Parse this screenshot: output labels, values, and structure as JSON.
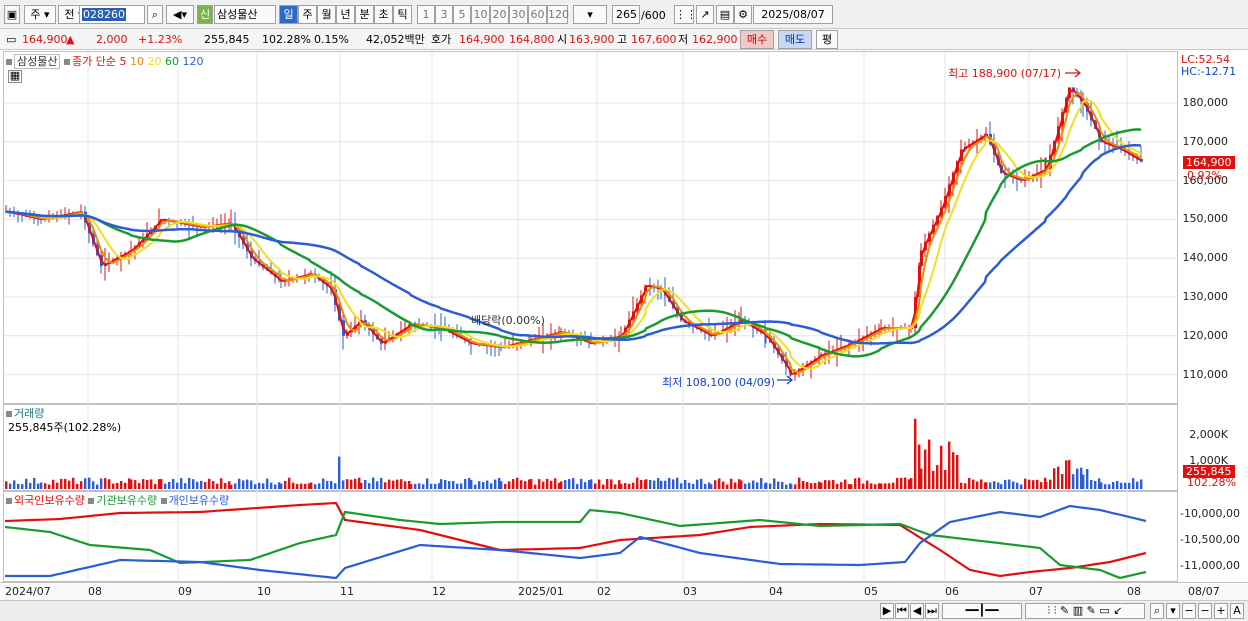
{
  "toolbar": {
    "type_select": "주",
    "range_select": "전",
    "code": "028260",
    "new_badge": "신",
    "stock_name": "삼성물산",
    "periods": [
      "일",
      "주",
      "월",
      "년",
      "분",
      "초",
      "틱"
    ],
    "intervals": [
      "1",
      "3",
      "5",
      "10",
      "20",
      "30",
      "60",
      "120"
    ],
    "count": "265",
    "total": "/600",
    "date": "2025/08/07"
  },
  "quote": {
    "price": "164,900",
    "change_arrow": "▲",
    "change": "2,000",
    "change_pct": "+1.23%",
    "volume": "255,845",
    "volume_ratio": "102.28%",
    "turnover": "0.15%",
    "amount": "42,052백만",
    "ask_label": "호가",
    "ask": "164,900",
    "bid": "164,800",
    "open_label": "시",
    "open": "163,900",
    "high_label": "고",
    "high": "167,600",
    "low_label": "저",
    "low": "162,900",
    "buy_button": "매수",
    "sell_button": "매도",
    "eval_button": "평"
  },
  "price_panel": {
    "stock_label": "삼성물산",
    "ma_label": "종가 단순",
    "ma_periods": [
      "5",
      "10",
      "20",
      "60",
      "120"
    ],
    "ma_colors": [
      "#e01010",
      "#f08a00",
      "#f0e020",
      "#1a9a30",
      "#2c5cd6"
    ],
    "lc": "LC:52.54",
    "hc": "HC:-12.71",
    "high_note": "최고 188,900 (07/17)",
    "low_note": "최저 108,100 (04/09)",
    "dividend_note": "배당락(0.00%)",
    "y_ticks": [
      "180,000",
      "170,000",
      "160,000",
      "150,000",
      "140,000",
      "130,000",
      "120,000",
      "110,000"
    ],
    "current_tag": "164,900",
    "current_pct": "0.92%"
  },
  "volume_panel": {
    "title": "거래량",
    "value": "255,845주(102.28%)",
    "y_ticks": [
      "2,000K",
      "1,000K"
    ],
    "current_tag": "255,845",
    "current_pct": "102.28%"
  },
  "holding_panel": {
    "series": [
      "외국인보유수량",
      "기관보유수량",
      "개인보유수량"
    ],
    "colors": [
      "#e01010",
      "#1a9a30",
      "#2c5cd6"
    ],
    "y_ticks": [
      "-10,000,00",
      "-10,500,00",
      "-11,000,00"
    ]
  },
  "x_axis": {
    "labels": [
      "2024/07",
      "08",
      "09",
      "10",
      "11",
      "12",
      "2025/01",
      "02",
      "03",
      "04",
      "05",
      "06",
      "07",
      "08"
    ],
    "right_label": "08/07"
  }
}
